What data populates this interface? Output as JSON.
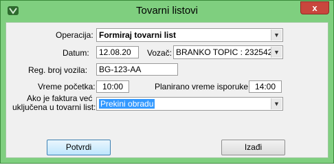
{
  "window": {
    "title": "Tovarni listovi",
    "close_label": "x"
  },
  "form": {
    "operacija_label": "Operacija:",
    "operacija_value": "Formiraj tovarni list",
    "datum_label": "Datum:",
    "datum_value": "12.08.20",
    "vozac_label": "Vozač:",
    "vozac_value": "BRANKO TOPIC : 232542",
    "reg_label": "Reg. broj vozila:",
    "reg_value": "BG-123-AA",
    "vreme_pocetka_label": "Vreme početka:",
    "vreme_pocetka_value": "10:00",
    "planirano_label": "Planirano vreme isporuke:",
    "planirano_value": "14:00",
    "faktura_label_line1": "Ako je faktura već",
    "faktura_label_line2": "uključena u tovarni list:",
    "faktura_value": "Prekini obradu"
  },
  "buttons": {
    "confirm_label": "Potvrdi",
    "exit_label": "Izađi"
  }
}
